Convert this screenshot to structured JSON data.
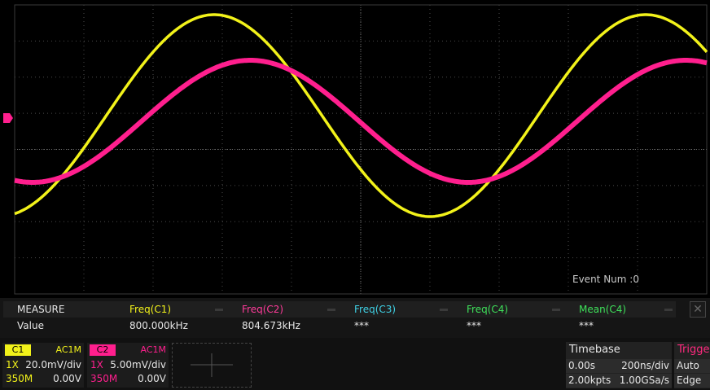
{
  "scope": {
    "event_label": "Event Num :0",
    "colors": {
      "ch1": "#f2f21a",
      "ch2": "#ff1f8e",
      "grid": "#4a4a4a",
      "dash_label": "#8a8a8a"
    },
    "channel2_marker_icon": "ground-level-marker"
  },
  "measure": {
    "title": "MEASURE",
    "row_label": "Value",
    "columns": [
      {
        "name": "Freq(C1)",
        "value": "800.000kHz",
        "color": "#f2f21a"
      },
      {
        "name": "Freq(C2)",
        "value": "804.673kHz",
        "color": "#ff3b9a"
      },
      {
        "name": "Freq(C3)",
        "value": "***",
        "color": "#3fd2e6"
      },
      {
        "name": "Freq(C4)",
        "value": "***",
        "color": "#3ee05a"
      },
      {
        "name": "Mean(C4)",
        "value": "***",
        "color": "#3ee05a"
      }
    ]
  },
  "channels": [
    {
      "tag": "C1",
      "coupling": "AC1M",
      "probe": "1X",
      "scale": "20.0mV/div",
      "bw": "350M",
      "offset": "0.00V",
      "tag_bg": "#f2f21a",
      "tag_fg": "#000000",
      "accent": "#f2f21a"
    },
    {
      "tag": "C2",
      "coupling": "AC1M",
      "probe": "1X",
      "scale": "5.00mV/div",
      "bw": "350M",
      "offset": "0.00V",
      "tag_bg": "#ff1f8e",
      "tag_fg": "#000000",
      "accent": "#ff1f8e"
    }
  ],
  "timebase": {
    "title": "Timebase",
    "delay": "0.00s",
    "scale": "200ns/div",
    "points": "2.00kpts",
    "rate": "1.00GSa/s"
  },
  "trigger": {
    "title": "Trigger",
    "mode": "Auto",
    "type": "Edge"
  }
}
